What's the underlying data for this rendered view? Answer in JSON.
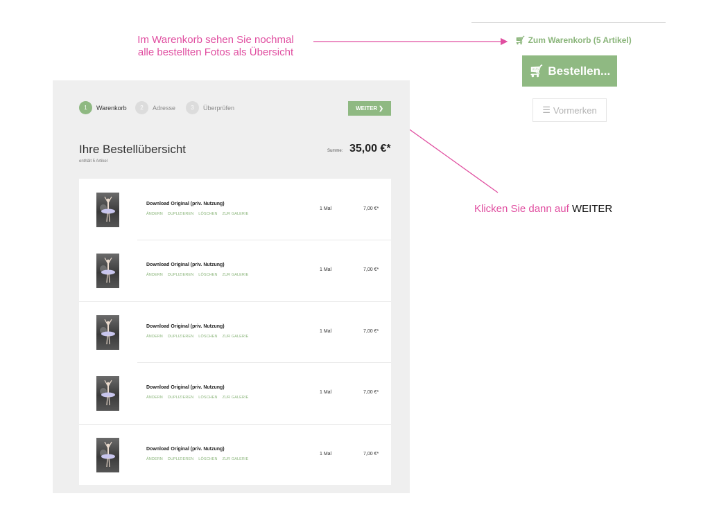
{
  "annotations": {
    "top_line1": "Im Warenkorb sehen Sie nochmal",
    "top_line2": "alle bestellten Fotos als Übersicht",
    "right_text": "Klicken Sie dann auf",
    "right_highlight": "WEITER"
  },
  "sidebar": {
    "cart_link_prefix": "Zum Warenkorb (",
    "cart_count": "5 Artikel",
    "cart_link_suffix": ")",
    "order_label": "Bestellen...",
    "note_label": "Vormerken"
  },
  "steps": [
    {
      "num": "1",
      "label": "Warenkorb"
    },
    {
      "num": "2",
      "label": "Adresse"
    },
    {
      "num": "3",
      "label": "Überprüfen"
    }
  ],
  "weiter_label": "WEITER",
  "overview": {
    "title": "Ihre Bestellübersicht",
    "subtitle": "enthält 5 Artikel",
    "sum_label": "Summe:",
    "sum_value": "35,00 €*"
  },
  "actions": [
    "ÄNDERN",
    "DUPLIZIEREN",
    "LÖSCHEN",
    "ZUR GALERIE"
  ],
  "items": [
    {
      "name": "Download Original (priv. Nutzung)",
      "qty": "1 Mal",
      "price": "7,00 €*"
    },
    {
      "name": "Download Original (priv. Nutzung)",
      "qty": "1 Mal",
      "price": "7,00 €*"
    },
    {
      "name": "Download Original (priv. Nutzung)",
      "qty": "1 Mal",
      "price": "7,00 €*"
    },
    {
      "name": "Download Original (priv. Nutzung)",
      "qty": "1 Mal",
      "price": "7,00 €*"
    },
    {
      "name": "Download Original (priv. Nutzung)",
      "qty": "1 Mal",
      "price": "7,00 €*"
    }
  ],
  "colors": {
    "accent_green": "#8fb982",
    "annotation_pink": "#e04ea0",
    "panel_gray": "#efefef"
  }
}
